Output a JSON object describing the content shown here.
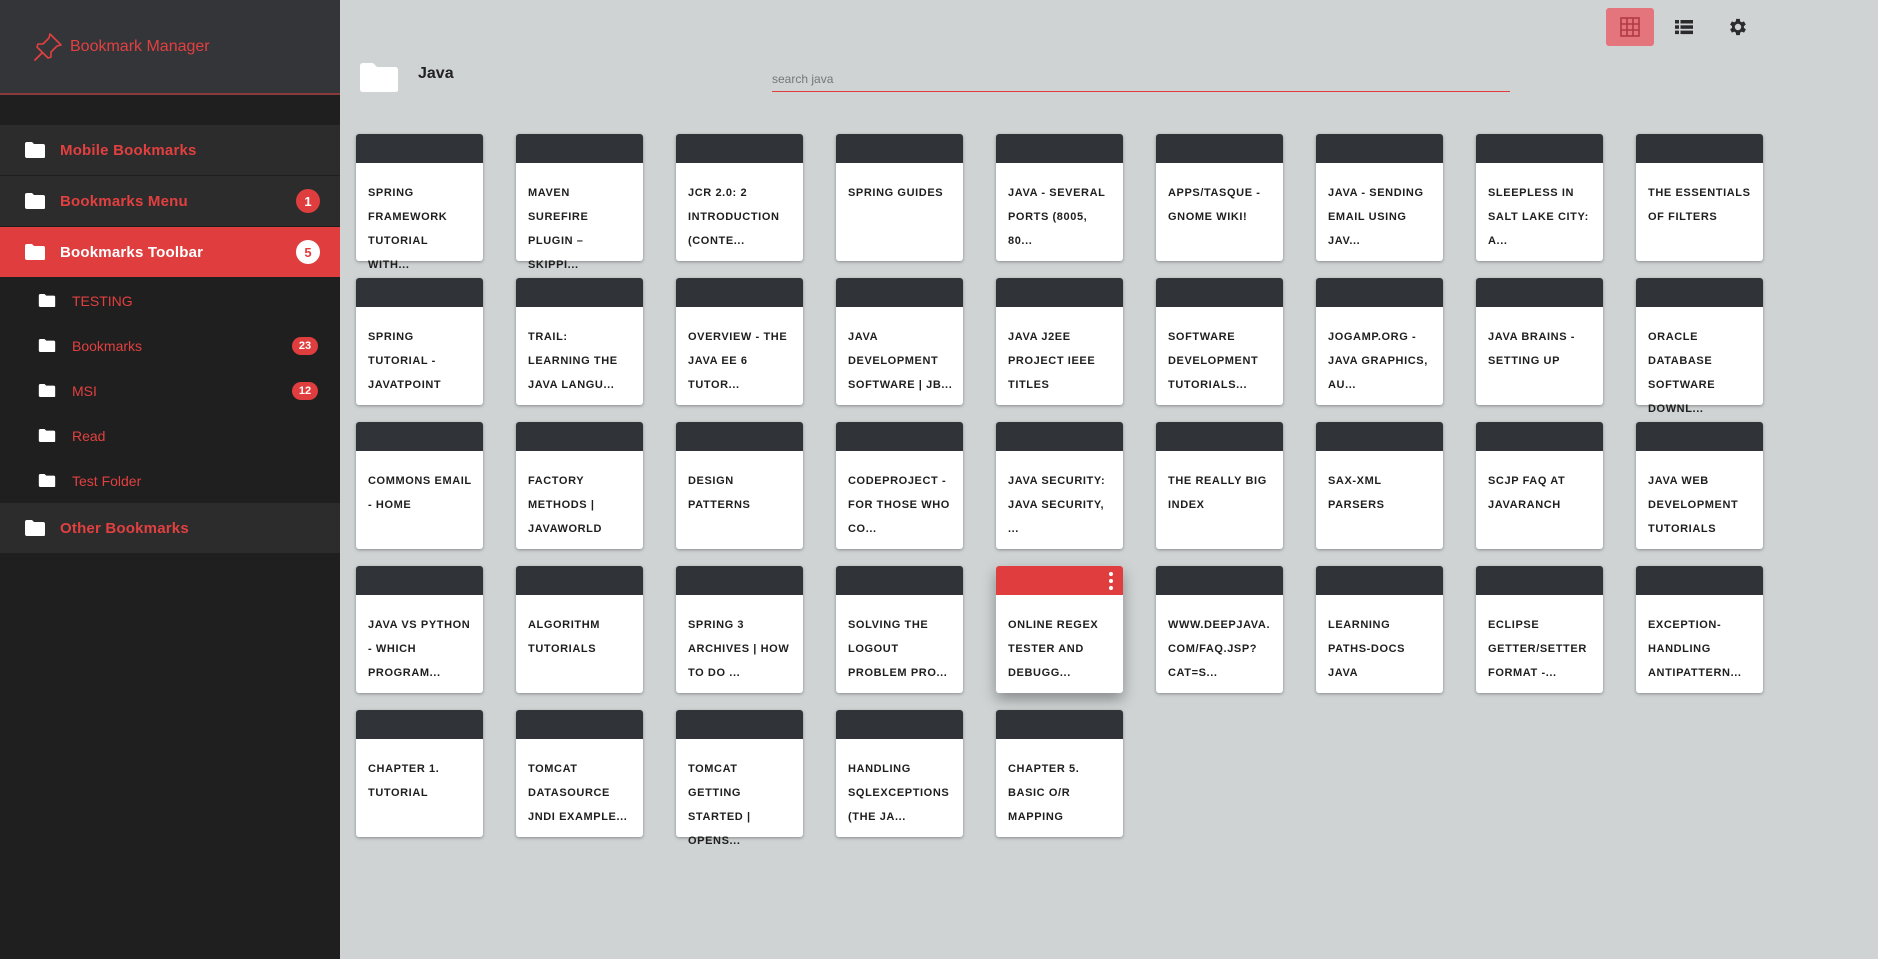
{
  "app": {
    "title": "Bookmark Manager"
  },
  "colors": {
    "accent": "#e03e3e",
    "sidebar": "#1f1f1f",
    "card_cap": "#303338",
    "background": "#cfd3d3"
  },
  "sidebar": {
    "items": [
      {
        "label": "Mobile Bookmarks",
        "badge": null,
        "active": false,
        "icon": "folder-icon"
      },
      {
        "label": "Bookmarks Menu",
        "badge": "1",
        "active": false,
        "icon": "folder-icon"
      },
      {
        "label": "Bookmarks Toolbar",
        "badge": "5",
        "active": true,
        "icon": "folder-icon"
      },
      {
        "label": "TESTING",
        "badge": null,
        "sub": true,
        "icon": "folder-icon"
      },
      {
        "label": "Bookmarks",
        "badge": "23",
        "sub": true,
        "icon": "folder-icon"
      },
      {
        "label": "MSI",
        "badge": "12",
        "sub": true,
        "icon": "folder-icon"
      },
      {
        "label": "Read",
        "badge": null,
        "sub": true,
        "icon": "folder-icon"
      },
      {
        "label": "Test Folder",
        "badge": null,
        "sub": true,
        "icon": "folder-icon"
      },
      {
        "label": "Other Bookmarks",
        "badge": null,
        "active": false,
        "icon": "folder-icon"
      }
    ]
  },
  "toolbar": {
    "buttons": [
      "grid-view-icon",
      "list-view-icon",
      "gear-icon"
    ],
    "active": "grid-view-icon"
  },
  "main": {
    "folder_name": "Java",
    "search_placeholder": "search java",
    "cards": [
      "SPRING FRAMEWORK TUTORIAL WITH...",
      "MAVEN SUREFIRE PLUGIN – SKIPPI...",
      "JCR 2.0: 2 INTRODUCTION (CONTE...",
      "SPRING GUIDES",
      "JAVA - SEVERAL PORTS (8005, 80...",
      "APPS/TASQUE - GNOME WIKI!",
      "JAVA - SENDING EMAIL USING JAV...",
      "SLEEPLESS IN SALT LAKE CITY: A...",
      "THE ESSENTIALS OF FILTERS",
      "SPRING TUTORIAL - JAVATPOINT",
      "TRAIL: LEARNING THE JAVA LANGU...",
      "OVERVIEW - THE JAVA EE 6 TUTOR...",
      "JAVA DEVELOPMENT SOFTWARE | JB...",
      "JAVA J2EE PROJECT IEEE TITLES",
      "SOFTWARE DEVELOPMENT TUTORIALS...",
      "JOGAMP.ORG - JAVA GRAPHICS, AU...",
      "JAVA BRAINS - SETTING UP",
      "ORACLE DATABASE SOFTWARE DOWNL...",
      "COMMONS EMAIL - HOME",
      "FACTORY METHODS | JAVAWORLD",
      "DESIGN PATTERNS",
      "CODEPROJECT - FOR THOSE WHO CO...",
      "JAVA SECURITY: JAVA SECURITY, ...",
      "THE REALLY BIG INDEX",
      "SAX-XML PARSERS",
      "SCJP FAQ AT JAVARANCH",
      "JAVA WEB DEVELOPMENT TUTORIALS",
      "JAVA VS PYTHON - WHICH PROGRAM...",
      "ALGORITHM TUTORIALS",
      "SPRING 3 ARCHIVES | HOW TO DO ...",
      "SOLVING THE LOGOUT PROBLEM PRO...",
      "ONLINE REGEX TESTER AND DEBUGG...",
      "WWW.DEEPJAVA.COM/FAQ.JSP?CAT=S...",
      "LEARNING PATHS-DOCS JAVA",
      "ECLIPSE GETTER/SETTER FORMAT -...",
      "EXCEPTION-HANDLING ANTIPATTERN...",
      "CHAPTER 1. TUTORIAL",
      "TOMCAT DATASOURCE JNDI EXAMPLE...",
      "TOMCAT GETTING STARTED | OPENS...",
      "HANDLING SQLEXCEPTIONS (THE JA...",
      "CHAPTER 5. BASIC O/R MAPPING"
    ],
    "hovered_card_index": 31
  }
}
